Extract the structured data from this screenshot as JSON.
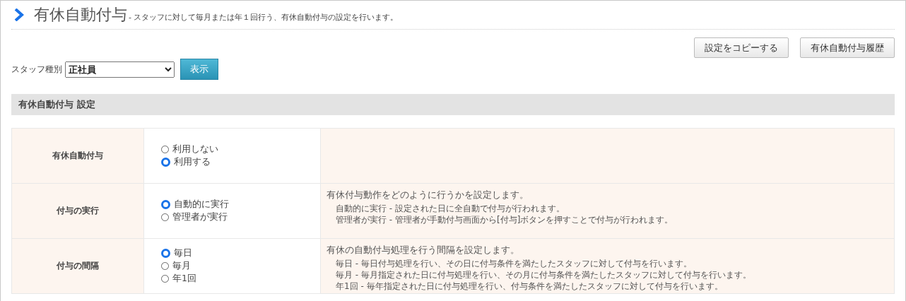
{
  "page_title": {
    "title": "有休自動付与",
    "subtitle": "- スタッフに対して毎月または年１回行う、有休自動付与の設定を行います。"
  },
  "buttons": [
    "設定をコピーする",
    "有休自動付与履歴"
  ],
  "filter": {
    "label": "スタッフ種別",
    "value": "正社員",
    "button": "表示"
  },
  "section": {
    "title": "有休自動付与 設定"
  },
  "rows": [
    {
      "label": "有休自動付与",
      "options": [
        {
          "label": "利用しない",
          "selected": false
        },
        {
          "label": "利用する",
          "selected": true
        }
      ]
    },
    {
      "label": "付与の実行",
      "options": [
        {
          "label": "自動的に実行",
          "selected": true
        },
        {
          "label": "管理者が実行",
          "selected": false
        }
      ],
      "description": {
        "heading": "有休付与動作をどのように行うかを設定します。",
        "lines": [
          "自動的に実行 - 設定された日に全自動で付与が行われます。",
          "管理者が実行 - 管理者が手動付与画面から[付与]ボタンを押すことで付与が行われます。"
        ]
      }
    },
    {
      "label": "付与の間隔",
      "options": [
        {
          "label": "毎日",
          "selected": true
        },
        {
          "label": "毎月",
          "selected": false
        },
        {
          "label": "年1回",
          "selected": false
        }
      ],
      "description": {
        "heading": "有休の自動付与処理を行う間隔を設定します。",
        "lines": [
          "毎日 - 毎日付与処理を行い、その日に付与条件を満たしたスタッフに対して付与を行います。",
          "毎月 - 毎月指定された日に付与処理を行い、その月に付与条件を満たしたスタッフに対して付与を行います。",
          "年1回 - 毎年指定された日に付与処理を行い、付与条件を満たしたスタッフに対して付与を行います。"
        ]
      }
    }
  ]
}
